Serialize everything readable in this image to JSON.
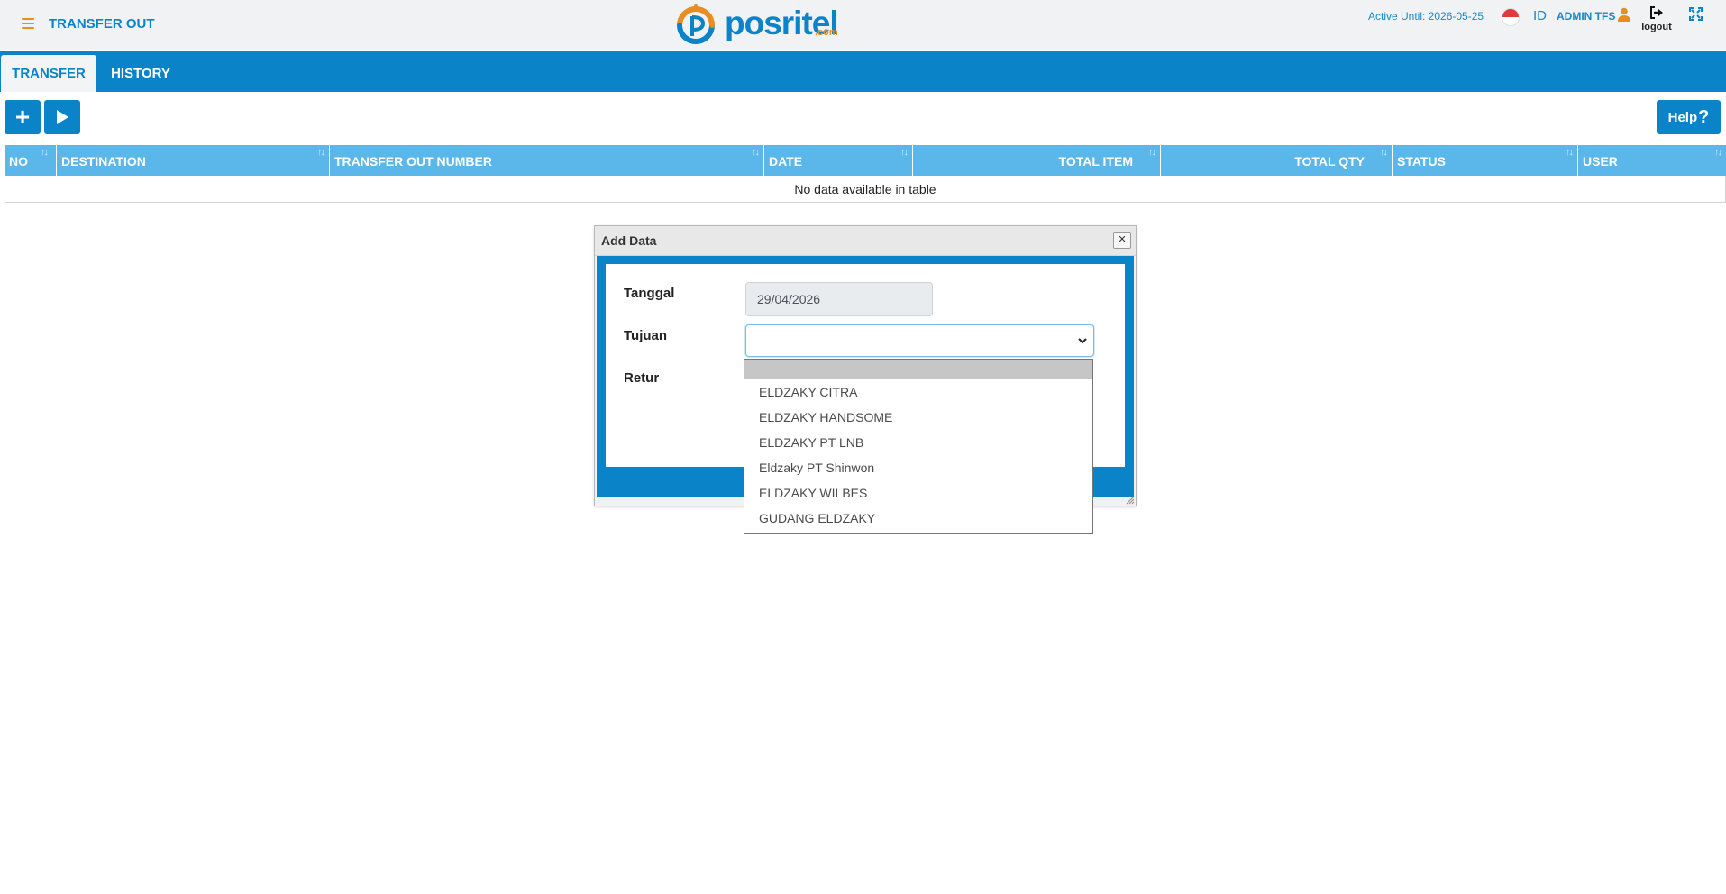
{
  "header": {
    "page_title": "TRANSFER OUT",
    "brand_word": "posritel",
    "brand_suffix": ".com",
    "active_until": "Active Until: 2026-05-25",
    "language": "ID",
    "user_name": "ADMIN TFS",
    "logout_label": "logout"
  },
  "tabs": [
    {
      "label": "TRANSFER",
      "active": true
    },
    {
      "label": "HISTORY",
      "active": false
    }
  ],
  "toolbar": {
    "add_label": "+",
    "help_label": "Help",
    "help_mark": "?"
  },
  "table": {
    "columns": [
      "NO",
      "DESTINATION",
      "TRANSFER OUT NUMBER",
      "DATE",
      "TOTAL ITEM",
      "TOTAL QTY",
      "STATUS",
      "USER"
    ],
    "empty_text": "No data available in table"
  },
  "dialog": {
    "title": "Add Data",
    "close_glyph": "×",
    "fields": {
      "tanggal_label": "Tanggal",
      "tanggal_value": "29/04/2026",
      "tujuan_label": "Tujuan",
      "tujuan_value": "",
      "retur_label": "Retur"
    }
  },
  "dropdown": {
    "options": [
      "",
      "ELDZAKY CITRA",
      "ELDZAKY HANDSOME",
      "ELDZAKY PT LNB",
      "Eldzaky PT Shinwon",
      "ELDZAKY WILBES",
      "GUDANG ELDZAKY"
    ]
  },
  "colors": {
    "primary": "#0a83c9",
    "header_row": "#5bb7e9",
    "accent": "#e98d21"
  }
}
